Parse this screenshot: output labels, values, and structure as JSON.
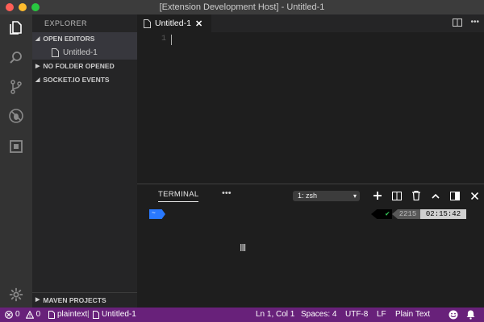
{
  "window": {
    "title": "[Extension Development Host] - Untitled-1",
    "traffic_colors": [
      "#ff5f57",
      "#febc2e",
      "#28c840"
    ]
  },
  "activity_bar": {
    "icons": [
      "files-icon",
      "search-icon",
      "source-control-icon",
      "debug-icon",
      "extensions-icon",
      "settings-gear-icon"
    ]
  },
  "sidebar": {
    "title": "EXPLORER",
    "open_editors_label": "OPEN EDITORS",
    "open_files": [
      {
        "name": "Untitled-1"
      }
    ],
    "no_folder_label": "NO FOLDER OPENED",
    "socket_label": "SOCKET.IO EVENTS",
    "maven_label": "MAVEN PROJECTS"
  },
  "editor": {
    "tab_label": "Untitled-1",
    "line_numbers": [
      "1"
    ]
  },
  "panel": {
    "tab_label": "TERMINAL",
    "more_label": "•••",
    "terminal_select": "1: zsh",
    "prompt_left": "~",
    "prompt_check": "✔",
    "prompt_number": "2215",
    "prompt_time": "02:15:42"
  },
  "status_bar": {
    "errors": "0",
    "warnings": "0",
    "language_mode_left": "plaintext",
    "file_name": "Untitled-1",
    "position": "Ln 1, Col 1",
    "spaces": "Spaces: 4",
    "encoding": "UTF-8",
    "eol": "LF",
    "language": "Plain Text",
    "background": "#68217a"
  }
}
